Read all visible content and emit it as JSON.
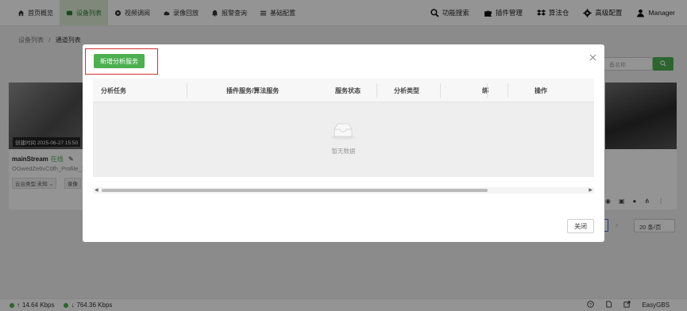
{
  "nav": {
    "items": [
      {
        "label": "首页概览",
        "icon": "home-icon",
        "active": false
      },
      {
        "label": "设备列表",
        "icon": "device-list-icon",
        "active": true
      },
      {
        "label": "视频调阅",
        "icon": "video-play-icon",
        "active": false
      },
      {
        "label": "录像回放",
        "icon": "cloud-icon",
        "active": false
      },
      {
        "label": "报警查询",
        "icon": "alarm-bell-icon",
        "active": false
      },
      {
        "label": "基础配置",
        "icon": "settings-list-icon",
        "active": false
      }
    ],
    "right_items": [
      {
        "label": "功能搜索",
        "icon": "search-icon"
      },
      {
        "label": "插件管理",
        "icon": "puzzle-icon"
      },
      {
        "label": "算法仓",
        "icon": "dropbox-icon"
      },
      {
        "label": "高级配置",
        "icon": "gear-icon"
      },
      {
        "label": "Manager",
        "icon": "user-icon"
      }
    ]
  },
  "breadcrumb": {
    "parent": "设备列表",
    "separator": "/",
    "current": "通道列表"
  },
  "background": {
    "search_placeholder": "备名称",
    "card": {
      "time": "创建时间 2025-06-27 15:50",
      "name": "mainStream",
      "status": "在线",
      "id": "OGwedZe6vC0fh_Profile_1",
      "tag1": "云台类型:未知",
      "tag2": "录像"
    },
    "page_size": "20 条/页"
  },
  "modal": {
    "add_button": "新增分析服务",
    "columns": [
      "分析任务",
      "插件服务/算法服务",
      "服务状态",
      "分析类型",
      "绑",
      "操作"
    ],
    "empty_text": "暂无数据",
    "close_button": "关闭",
    "scroll_position": 0
  },
  "footer": {
    "upload": "14.64 Kbps",
    "download": "764.36 Kbps",
    "brand": "EasyGBS"
  },
  "colors": {
    "accent": "#4caf50",
    "highlight": "#d32f2f",
    "nav_active_bg": "#dcebd6"
  }
}
